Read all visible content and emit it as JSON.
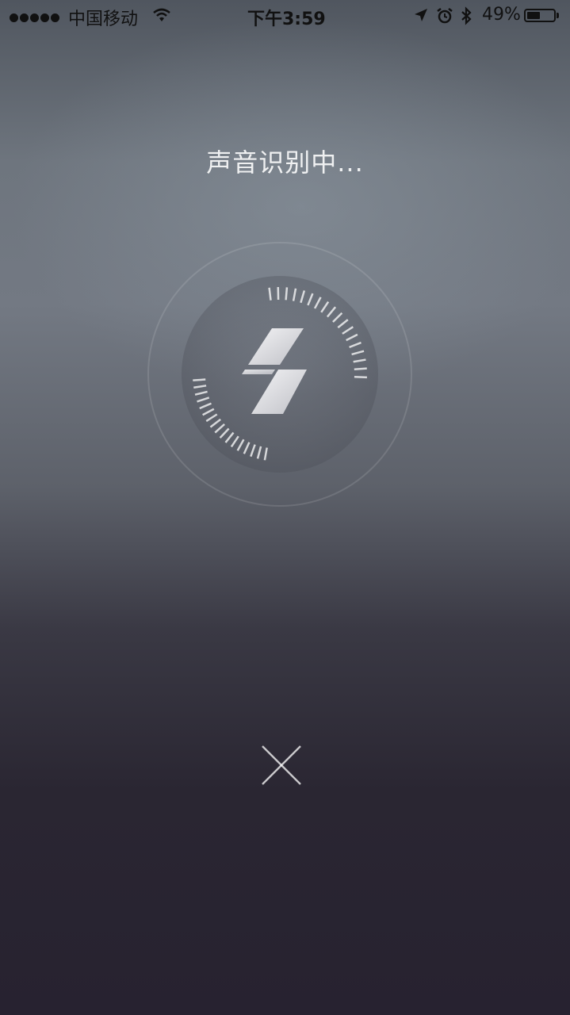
{
  "status_bar": {
    "carrier": "中国移动",
    "time": "下午3:59",
    "battery_percent_label": "49%",
    "battery_level": 0.49,
    "signal_bars": 5,
    "icons": [
      "signal-dots-icon",
      "wifi-icon",
      "location-arrow-icon",
      "alarm-icon",
      "bluetooth-icon",
      "battery-icon"
    ]
  },
  "main": {
    "status_text": "声音识别中...",
    "center_icon": "lightning-logo-icon",
    "close_icon": "close-icon"
  },
  "colors": {
    "text": "#ffffff",
    "status_text": "#111111",
    "background_top": "#6e757e",
    "background_bottom": "#272230"
  }
}
